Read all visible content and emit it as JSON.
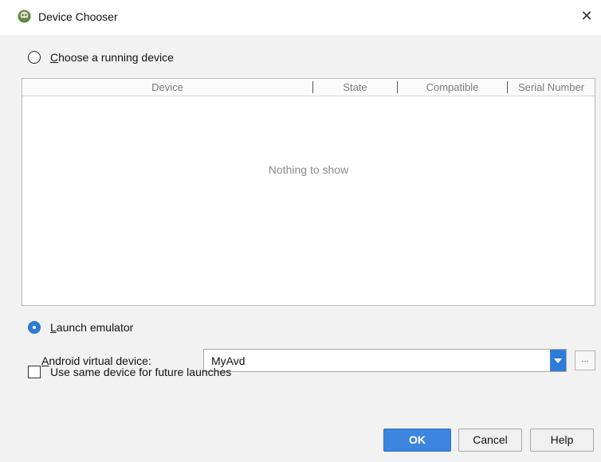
{
  "window": {
    "title": "Device Chooser",
    "icon": "android-studio-icon",
    "close_glyph": "✕"
  },
  "running_device": {
    "label_mnemonic": "C",
    "label_rest": "hoose a running device",
    "selected": false,
    "table": {
      "columns": [
        "Device",
        "State",
        "Compatible",
        "Serial Number"
      ],
      "rows": [],
      "empty_text": "Nothing to show"
    }
  },
  "launch_emulator": {
    "label_mnemonic": "L",
    "label_rest": "aunch emulator",
    "selected": true,
    "avd_label_mnemonic": "A",
    "avd_label_rest": "ndroid virtual device:",
    "avd_value": "MyAvd",
    "browse_label": "..."
  },
  "same_device": {
    "label": "Use same device for future launches",
    "checked": false
  },
  "buttons": {
    "ok": "OK",
    "cancel": "Cancel",
    "help": "Help"
  },
  "colors": {
    "accent": "#2f7bd9",
    "ok_button": "#3d85de",
    "background": "#f2f2f2"
  }
}
